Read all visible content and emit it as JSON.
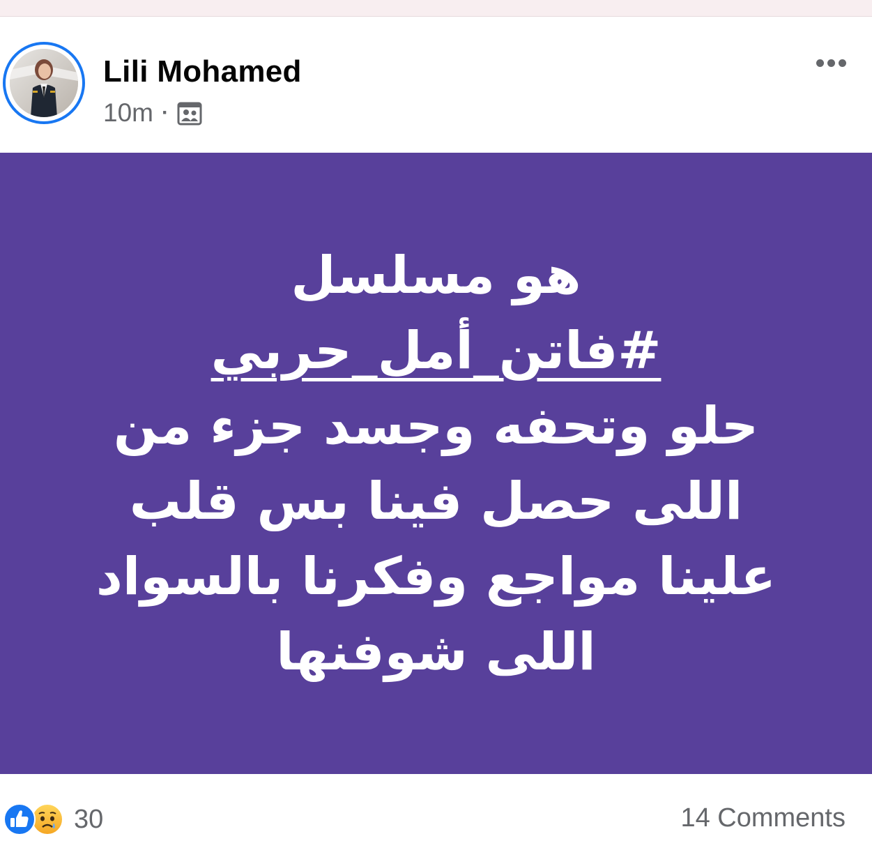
{
  "post": {
    "author": "Lili Mohamed",
    "timestamp": "10m",
    "separator": "·",
    "audience_icon": "friends-audience-icon",
    "more_icon": "more-options-icon"
  },
  "status": {
    "background_color": "#58409b",
    "text_color": "#ffffff",
    "line1": "هو مسلسل",
    "hashtag": "#فاتن_أمل_حربي",
    "line3": "حلو وتحفه وجسد جزء من",
    "line4": "اللى حصل فينا بس قلب",
    "line5": "علينا مواجع وفكرنا بالسواد",
    "line6": "اللى شوفنها"
  },
  "footer": {
    "reactions": [
      "like",
      "sad"
    ],
    "reaction_count": "30",
    "comments": "14 Comments"
  },
  "colors": {
    "accent": "#1877f2",
    "secondary_text": "#65676b"
  }
}
